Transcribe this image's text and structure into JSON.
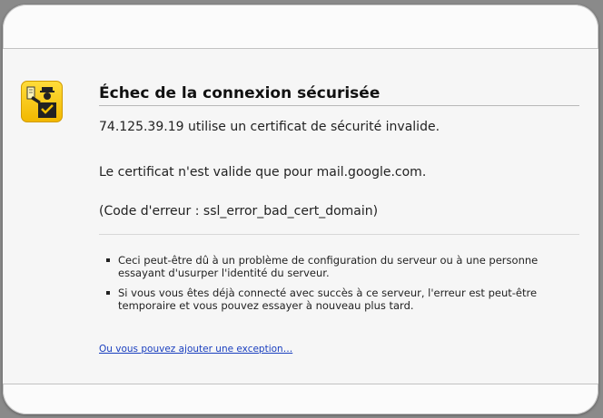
{
  "error": {
    "icon": "security-officer-icon",
    "icon_color": "#f5c100",
    "title": "Échec de la connexion sécurisée",
    "message": "74.125.39.19 utilise un certificat de sécurité invalide.",
    "detail": "Le certificat n'est valide que pour mail.google.com.",
    "error_code": "(Code d'erreur : ssl_error_bad_cert_domain)",
    "bullets": [
      "Ceci peut-être dû à un problème de configuration du serveur ou à une personne essayant d'usurper l'identité du serveur.",
      "Si vous vous êtes déjà connecté avec succès à ce serveur, l'erreur est peut-être temporaire et vous pouvez essayer à nouveau plus tard."
    ],
    "exception_link": "Ou vous pouvez ajouter une exception…",
    "link_color": "#1a3fbf"
  }
}
